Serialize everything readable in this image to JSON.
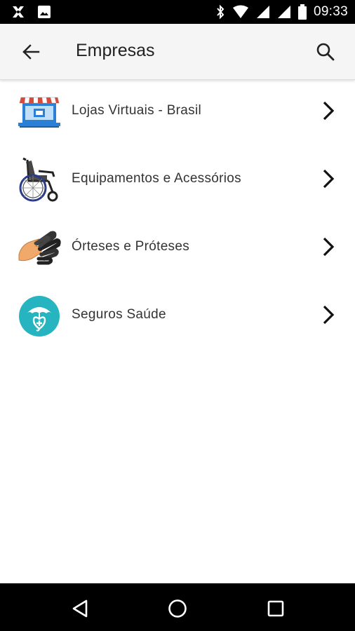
{
  "status_bar": {
    "time": "09:33",
    "icons": [
      "app-notification-icon",
      "image-notification-icon",
      "bluetooth-icon",
      "wifi-icon",
      "signal-icon",
      "signal-icon",
      "battery-icon"
    ]
  },
  "app_bar": {
    "title": "Empresas",
    "back_icon": "arrow-back-icon",
    "search_icon": "search-icon"
  },
  "list": {
    "items": [
      {
        "label": "Lojas Virtuais - Brasil",
        "icon": "storefront-icon"
      },
      {
        "label": "Equipamentos e Acessórios",
        "icon": "wheelchair-icon"
      },
      {
        "label": "Órteses e Próteses",
        "icon": "prosthetic-hand-icon"
      },
      {
        "label": "Seguros Saúde",
        "icon": "health-insurance-icon"
      }
    ]
  },
  "nav_bar": {
    "icons": [
      "back-triangle-icon",
      "home-circle-icon",
      "recents-square-icon"
    ]
  },
  "colors": {
    "status_bar_bg": "#000000",
    "app_bar_bg": "#f5f5f5",
    "teal_accent": "#26b5c0",
    "store_blue": "#2c7fd6",
    "awning_red": "#d84a3b"
  }
}
